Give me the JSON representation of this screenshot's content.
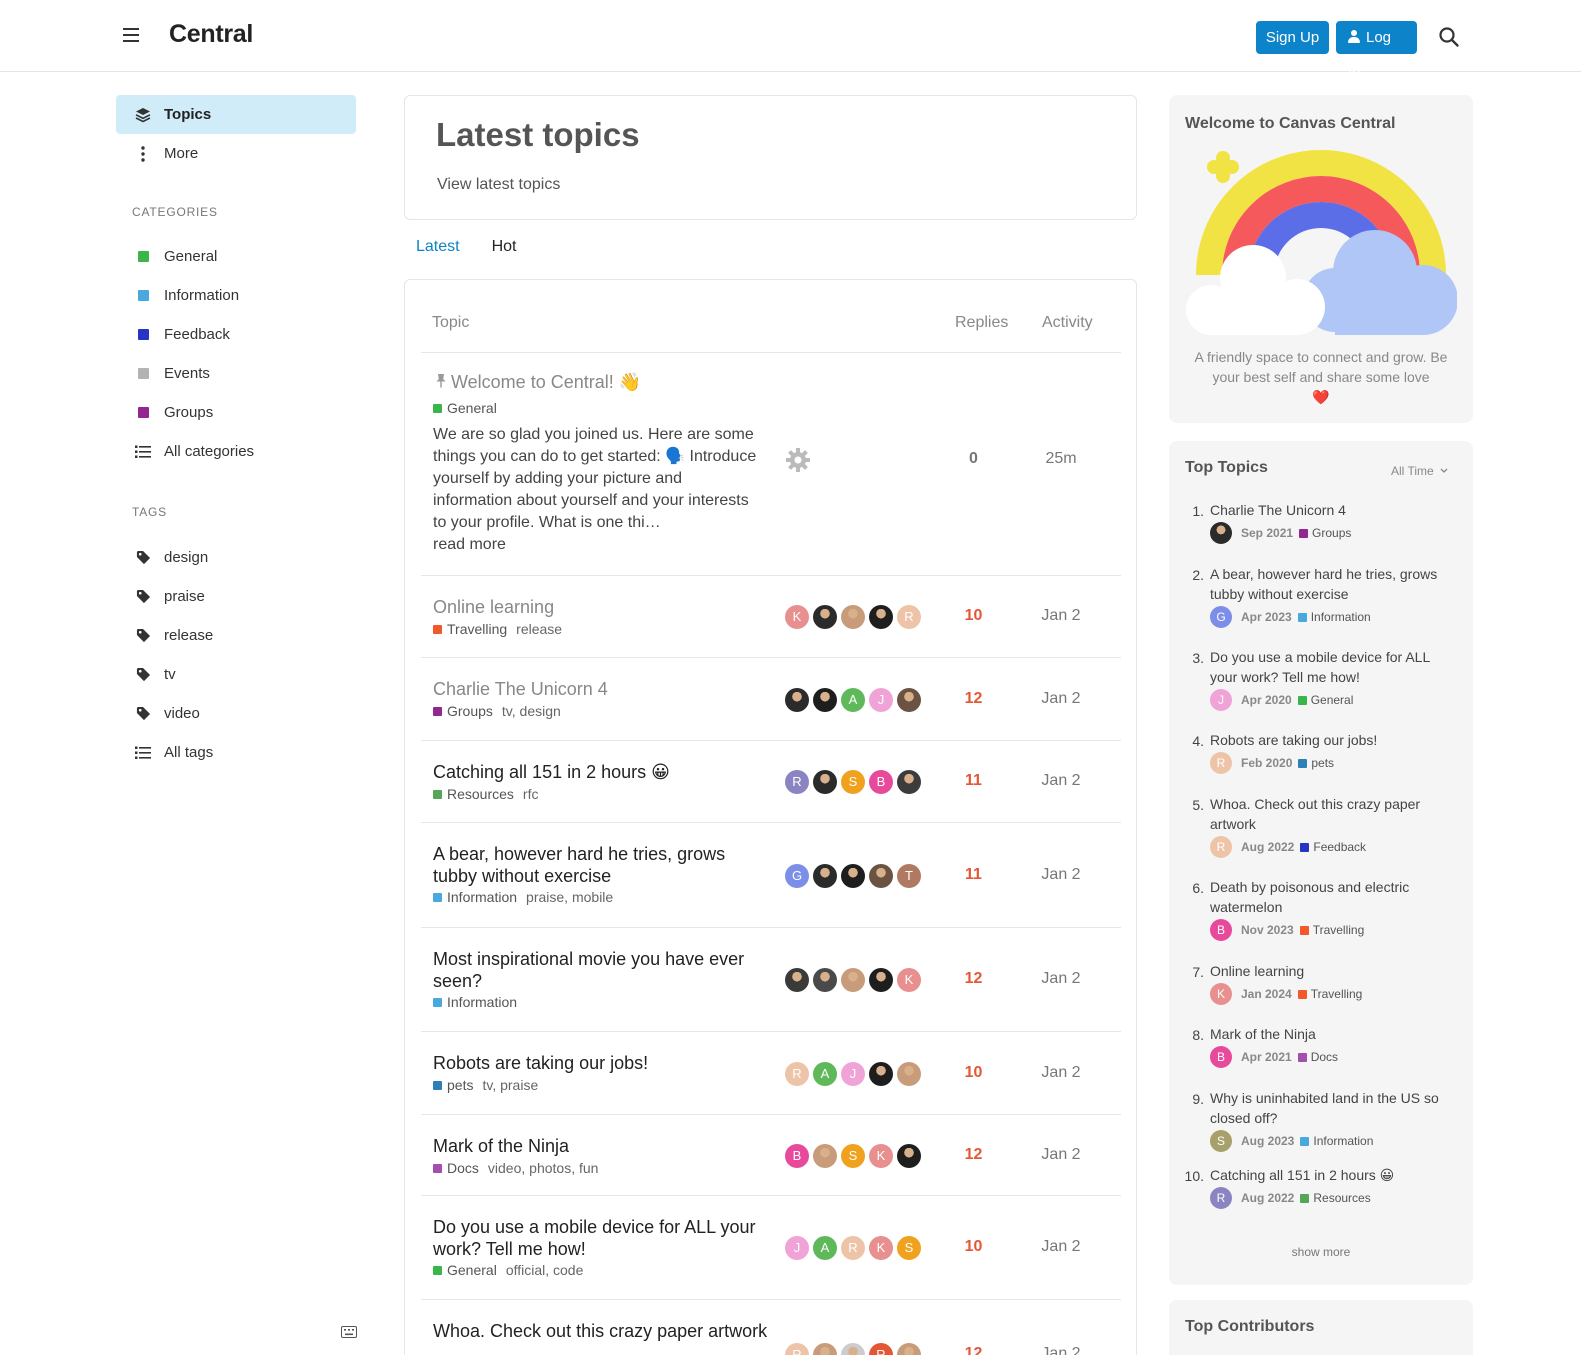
{
  "header": {
    "brand": "Central",
    "signup_label": "Sign Up",
    "login_label": "Log In"
  },
  "sidebar": {
    "nav": [
      {
        "label": "Topics"
      },
      {
        "label": "More"
      }
    ],
    "categories_heading": "CATEGORIES",
    "categories": [
      {
        "label": "General",
        "color": "#3ab54a"
      },
      {
        "label": "Information",
        "color": "#49a9de"
      },
      {
        "label": "Feedback",
        "color": "#2633c4"
      },
      {
        "label": "Events",
        "color": "#b3b3b3"
      },
      {
        "label": "Groups",
        "color": "#92278f"
      }
    ],
    "all_categories": "All categories",
    "tags_heading": "TAGS",
    "tags": [
      {
        "label": "design"
      },
      {
        "label": "praise"
      },
      {
        "label": "release"
      },
      {
        "label": "tv"
      },
      {
        "label": "video"
      }
    ],
    "all_tags": "All tags"
  },
  "main": {
    "title": "Latest topics",
    "subtitle": "View latest topics",
    "tabs": [
      {
        "label": "Latest"
      },
      {
        "label": "Hot"
      }
    ],
    "columns": {
      "topic": "Topic",
      "replies": "Replies",
      "activity": "Activity"
    },
    "topics": [
      {
        "title": "Welcome to Central! 👋",
        "category": "General",
        "category_color": "#3ab54a",
        "tags": "",
        "excerpt": "We are so glad you joined us. Here are some things you can do to get started: 🗣️ Introduce yourself by adding your picture and information about yourself and your interests to your profile. What is one thi…",
        "read_more": "read more",
        "replies": "0",
        "activity": "25m"
      },
      {
        "title": "Online learning",
        "category": "Travelling",
        "category_color": "#f1592a",
        "tags": "release",
        "avatars": [
          {
            "letter": "K",
            "color": "#e88f8f"
          },
          {
            "letter": "",
            "color": "#2b2b2b"
          },
          {
            "letter": "",
            "color": "#c89b7b"
          },
          {
            "letter": "",
            "color": "#1e1e1e"
          },
          {
            "letter": "R",
            "color": "#eec4a8"
          }
        ],
        "replies": "10",
        "activity": "Jan 2"
      },
      {
        "title": "Charlie The Unicorn 4",
        "category": "Groups",
        "category_color": "#92278f",
        "tags": "tv, design",
        "avatars": [
          {
            "letter": "",
            "color": "#2b2b2b"
          },
          {
            "letter": "",
            "color": "#1e1e1e"
          },
          {
            "letter": "A",
            "color": "#5fb85a"
          },
          {
            "letter": "J",
            "color": "#f0a3d6"
          },
          {
            "letter": "",
            "color": "#6b5344"
          }
        ],
        "replies": "12",
        "activity": "Jan 2"
      },
      {
        "title": "Catching all 151 in 2 hours 😀",
        "category": "Resources",
        "category_color": "#56a65a",
        "tags": "rfc",
        "avatars": [
          {
            "letter": "R",
            "color": "#8a85c2"
          },
          {
            "letter": "",
            "color": "#2b2b2b"
          },
          {
            "letter": "S",
            "color": "#f0a21e"
          },
          {
            "letter": "B",
            "color": "#e84a9b"
          },
          {
            "letter": "",
            "color": "#3c3c3c"
          }
        ],
        "replies": "11",
        "activity": "Jan 2"
      },
      {
        "title": "A bear, however hard he tries, grows tubby without exercise",
        "category": "Information",
        "category_color": "#49a9de",
        "tags": "praise, mobile",
        "avatars": [
          {
            "letter": "G",
            "color": "#7c8ee8"
          },
          {
            "letter": "",
            "color": "#2b2b2b"
          },
          {
            "letter": "",
            "color": "#1e1e1e"
          },
          {
            "letter": "",
            "color": "#6b5344"
          },
          {
            "letter": "T",
            "color": "#b07a62"
          }
        ],
        "replies": "11",
        "activity": "Jan 2"
      },
      {
        "title": "Most inspirational movie you have ever seen?",
        "category": "Information",
        "category_color": "#49a9de",
        "tags": "",
        "avatars": [
          {
            "letter": "",
            "color": "#3a3a3a"
          },
          {
            "letter": "",
            "color": "#4a4a4a"
          },
          {
            "letter": "",
            "color": "#c89b7b"
          },
          {
            "letter": "",
            "color": "#1e1e1e"
          },
          {
            "letter": "K",
            "color": "#e88f8f"
          }
        ],
        "replies": "12",
        "activity": "Jan 2"
      },
      {
        "title": "Robots are taking our jobs!",
        "category": "pets",
        "category_color": "#2f7fb7",
        "tags": "tv, praise",
        "avatars": [
          {
            "letter": "R",
            "color": "#eec4a8"
          },
          {
            "letter": "A",
            "color": "#5fb85a"
          },
          {
            "letter": "J",
            "color": "#f0a3d6"
          },
          {
            "letter": "",
            "color": "#1e1e1e"
          },
          {
            "letter": "",
            "color": "#c89b7b"
          }
        ],
        "replies": "10",
        "activity": "Jan 2"
      },
      {
        "title": "Mark of the Ninja",
        "category": "Docs",
        "category_color": "#a34fae",
        "tags": "video, photos, fun",
        "avatars": [
          {
            "letter": "B",
            "color": "#e84a9b"
          },
          {
            "letter": "",
            "color": "#c89b7b"
          },
          {
            "letter": "S",
            "color": "#f0a21e"
          },
          {
            "letter": "K",
            "color": "#e88f8f"
          },
          {
            "letter": "",
            "color": "#1e1e1e"
          }
        ],
        "replies": "12",
        "activity": "Jan 2"
      },
      {
        "title": "Do you use a mobile device for ALL your work? Tell me how!",
        "category": "General",
        "category_color": "#3ab54a",
        "tags": "official, code",
        "avatars": [
          {
            "letter": "J",
            "color": "#f0a3d6"
          },
          {
            "letter": "A",
            "color": "#5fb85a"
          },
          {
            "letter": "R",
            "color": "#eec4a8"
          },
          {
            "letter": "K",
            "color": "#e88f8f"
          },
          {
            "letter": "S",
            "color": "#f0a21e"
          }
        ],
        "replies": "10",
        "activity": "Jan 2"
      },
      {
        "title": "Whoa. Check out this crazy paper artwork",
        "category": "",
        "category_color": "#2633c4",
        "tags": "",
        "avatars": [
          {
            "letter": "R",
            "color": "#eec4a8"
          },
          {
            "letter": "",
            "color": "#c89b7b"
          },
          {
            "letter": "",
            "color": "#cccccc"
          },
          {
            "letter": "R",
            "color": "#e45735"
          },
          {
            "letter": "",
            "color": "#c89b7b"
          }
        ],
        "replies": "12",
        "activity": "Jan 2"
      }
    ]
  },
  "welcome": {
    "title": "Welcome to Canvas Central",
    "blurb": "A friendly space to connect and grow. Be your best self and share some love",
    "heart": "❤️"
  },
  "top_topics": {
    "title": "Top Topics",
    "period": "All Time",
    "items": [
      {
        "num": "1.",
        "title": "Charlie The Unicorn 4",
        "date": "Sep 2021",
        "category": "Groups",
        "cat_color": "#92278f",
        "av_letter": "",
        "av_color": "#2b2b2b"
      },
      {
        "num": "2.",
        "title": "A bear, however hard he tries, grows tubby without exercise",
        "date": "Apr 2023",
        "category": "Information",
        "cat_color": "#49a9de",
        "av_letter": "G",
        "av_color": "#7c8ee8"
      },
      {
        "num": "3.",
        "title": "Do you use a mobile device for ALL your work? Tell me how!",
        "date": "Apr 2020",
        "category": "General",
        "cat_color": "#3ab54a",
        "av_letter": "J",
        "av_color": "#f0a3d6"
      },
      {
        "num": "4.",
        "title": "Robots are taking our jobs!",
        "date": "Feb 2020",
        "category": "pets",
        "cat_color": "#2f7fb7",
        "av_letter": "R",
        "av_color": "#eec4a8"
      },
      {
        "num": "5.",
        "title": "Whoa. Check out this crazy paper artwork",
        "date": "Aug 2022",
        "category": "Feedback",
        "cat_color": "#2633c4",
        "av_letter": "R",
        "av_color": "#eec4a8"
      },
      {
        "num": "6.",
        "title": "Death by poisonous and electric watermelon",
        "date": "Nov 2023",
        "category": "Travelling",
        "cat_color": "#f1592a",
        "av_letter": "B",
        "av_color": "#e84a9b"
      },
      {
        "num": "7.",
        "title": "Online learning",
        "date": "Jan 2024",
        "category": "Travelling",
        "cat_color": "#f1592a",
        "av_letter": "K",
        "av_color": "#e88f8f"
      },
      {
        "num": "8.",
        "title": "Mark of the Ninja",
        "date": "Apr 2021",
        "category": "Docs",
        "cat_color": "#a34fae",
        "av_letter": "B",
        "av_color": "#e84a9b"
      },
      {
        "num": "9.",
        "title": "Why is uninhabited land in the US so closed off?",
        "date": "Aug 2023",
        "category": "Information",
        "cat_color": "#49a9de",
        "av_letter": "S",
        "av_color": "#a8a06a"
      },
      {
        "num": "10.",
        "title": "Catching all 151 in 2 hours 😀",
        "date": "Aug 2022",
        "category": "Resources",
        "cat_color": "#56a65a",
        "av_letter": "R",
        "av_color": "#8a85c2"
      }
    ],
    "show_more": "show more"
  },
  "top_contributors": {
    "title": "Top Contributors"
  }
}
